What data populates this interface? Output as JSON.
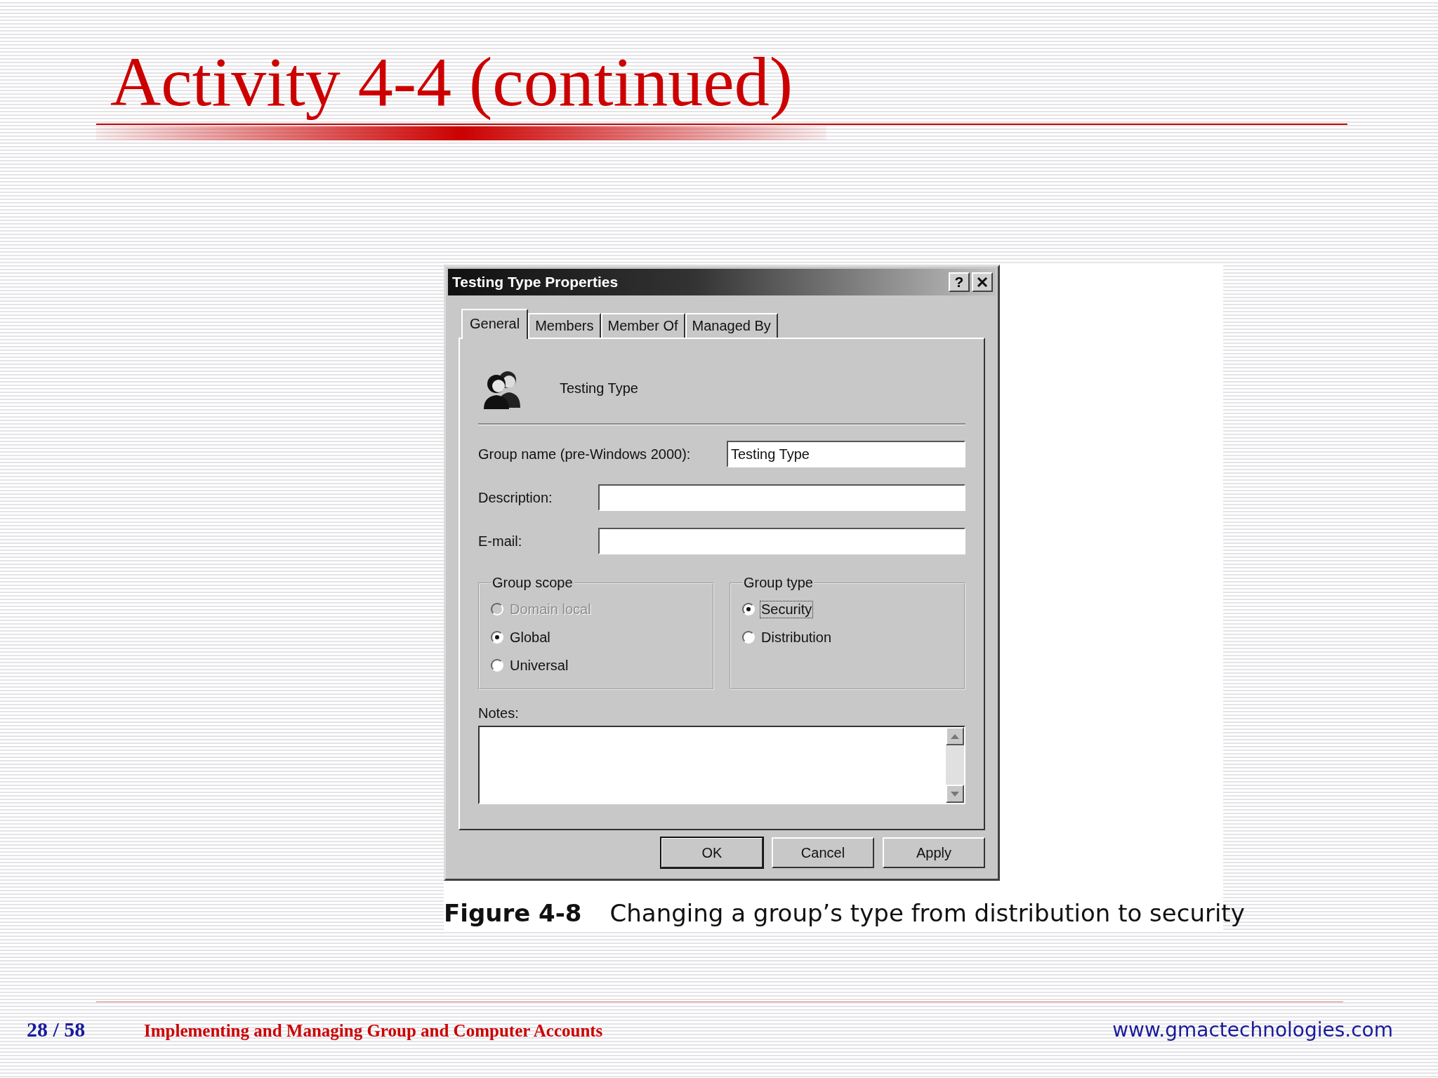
{
  "slide": {
    "title": "Activity 4-4 (continued)"
  },
  "dialog": {
    "title": "Testing Type Properties",
    "help_button": "?",
    "tabs": [
      {
        "label": "General",
        "selected": true
      },
      {
        "label": "Members",
        "selected": false
      },
      {
        "label": "Member Of",
        "selected": false
      },
      {
        "label": "Managed By",
        "selected": false
      }
    ],
    "object_name": "Testing Type",
    "fields": [
      {
        "label": "Group name (pre-Windows 2000):",
        "value": "Testing Type",
        "kind": "wide-label"
      },
      {
        "label": "Description:",
        "kind": "short-label"
      },
      {
        "label": "E-mail:",
        "kind": "short-label"
      }
    ],
    "groups": [
      {
        "title": "Group scope",
        "options": [
          {
            "label": "Domain local",
            "selected": false,
            "disabled": true,
            "focused": false
          },
          {
            "label": "Global",
            "selected": true,
            "disabled": false,
            "focused": false
          },
          {
            "label": "Universal",
            "selected": false,
            "disabled": false,
            "focused": false
          }
        ]
      },
      {
        "title": "Group type",
        "options": [
          {
            "label": "Security",
            "selected": true,
            "disabled": false,
            "focused": true
          },
          {
            "label": "Distribution",
            "selected": false,
            "disabled": false,
            "focused": false
          }
        ]
      }
    ],
    "notes_label": "Notes:",
    "buttons": [
      {
        "label": "OK",
        "default": true
      },
      {
        "label": "Cancel",
        "default": false
      },
      {
        "label": "Apply",
        "default": false
      }
    ]
  },
  "caption": {
    "label": "Figure 4-8",
    "text": "Changing a group’s type from distribution to security"
  },
  "footer": {
    "page": "28 / 58",
    "course": "Implementing and Managing Group and Computer Accounts",
    "website": "www.gmactechnologies.com"
  }
}
